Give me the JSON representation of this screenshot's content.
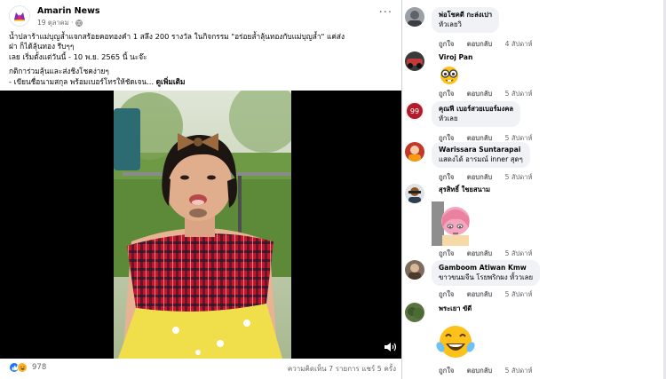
{
  "post": {
    "page_name": "Amarin News",
    "date": "19 ตุลาคม ·",
    "text_lines": [
      "น้ำปลาร้าแม่บุญล้ำแจกสร้อยคอทองคำ 1 สลึง 200 รางวัล ในกิจกรรม \"อร่อยล้ำลุ้นทองกับแม่บุญล้ำ\" แค่ส่ง",
      "ฝา ก็ได้ลุ้นทอง รีบๆๆ",
      "เลย เริ่มตั้งแต่วันนี้ - 10 พ.ย. 2565 นี้ นะจ๊ะ"
    ],
    "text_lines_2": [
      "กติการ่วมลุ้นและส่งชิงโชคง่ายๆ",
      "- เขียนชื่อนามสกุล พร้อมเบอร์โทรให้ชัดเจน..."
    ],
    "see_more": "ดูเพิ่มเติม",
    "reaction_count": "978",
    "stats": "ความคิดเห็น 7 รายการ  แชร์ 5 ครั้ง"
  },
  "comments": [
    {
      "name": "พ่อโชคดี กะล่งเปา",
      "text": "หัวเลยวิ",
      "like": "ถูกใจ",
      "reply": "ตอบกลับ",
      "time": "4 สัปดาห์"
    },
    {
      "name": "Viroj Pan",
      "text": "",
      "like": "ถูกใจ",
      "reply": "ตอบกลับ",
      "time": "5 สัปดาห์"
    },
    {
      "name": "คุณฟี เบอร์สวยเบอร์มงคล",
      "text": "หัวเลย",
      "like": "ถูกใจ",
      "reply": "ตอบกลับ",
      "time": "5 สัปดาห์"
    },
    {
      "name": "Warissara Suntarapai",
      "text": "แสดงได้ อารมณ์ inner สุดๆ",
      "like": "ถูกใจ",
      "reply": "ตอบกลับ",
      "time": "5 สัปดาห์"
    },
    {
      "name": "สุรสิทธิ์ ใชยสนาม",
      "text": "",
      "like": "ถูกใจ",
      "reply": "ตอบกลับ",
      "time": "5 สัปดาห์"
    },
    {
      "name": "Gamboom Atiwan Kmw",
      "text": "ขาวขนมจีน โรยพริกผง หั้ววเลย",
      "like": "ถูกใจ",
      "reply": "ตอบกลับ",
      "time": "5 สัปดาห์"
    },
    {
      "name": "พระเยา ขัดี",
      "text": "",
      "like": "ถูกใจ",
      "reply": "ตอบกลับ",
      "time": "5 สัปดาห์"
    }
  ],
  "colors": {
    "link_blue": "#1877f2",
    "bubble_bg": "#f0f2f5",
    "secondary_text": "#65676b"
  }
}
